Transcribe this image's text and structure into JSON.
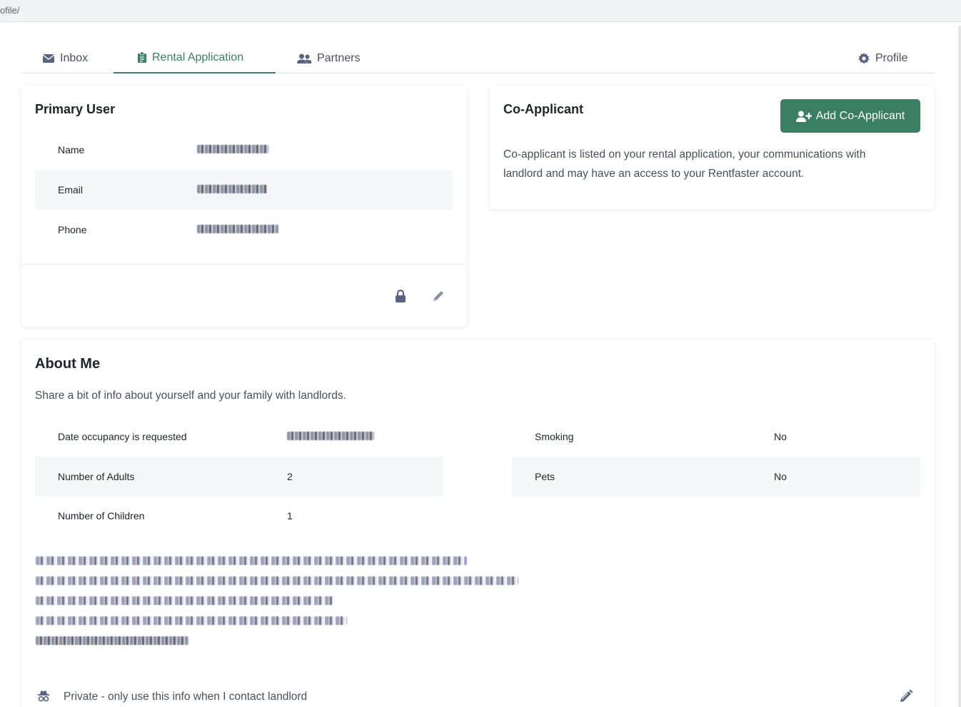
{
  "browser": {
    "url_fragment": "ofile/"
  },
  "tabs": [
    {
      "label": "Inbox",
      "icon": "envelope-icon"
    },
    {
      "label": "Rental Application",
      "icon": "clipboard-icon",
      "active": true
    },
    {
      "label": "Partners",
      "icon": "users-icon"
    },
    {
      "label": "Profile",
      "icon": "gear-icon"
    }
  ],
  "primary_user": {
    "title": "Primary User",
    "fields": [
      {
        "label": "Name",
        "value": "[redacted]"
      },
      {
        "label": "Email",
        "value": "[redacted]"
      },
      {
        "label": "Phone",
        "value": "[redacted]"
      }
    ]
  },
  "co_applicant": {
    "title": "Co-Applicant",
    "add_button": "Add Co-Applicant",
    "description_line1": "Co-applicant is listed on your rental application, your communications with",
    "description_line2": "landlord and may have an access to your Rentfaster account."
  },
  "about_me": {
    "title": "About Me",
    "subtitle": "Share a bit of info about yourself and your family with landlords.",
    "left_fields": [
      {
        "label": "Date occupancy is requested",
        "value": "[redacted]"
      },
      {
        "label": "Number of Adults",
        "value": "2"
      },
      {
        "label": "Number of Children",
        "value": "1"
      }
    ],
    "right_fields": [
      {
        "label": "Smoking",
        "value": "No"
      },
      {
        "label": "Pets",
        "value": "No"
      }
    ],
    "bio_lines": [
      "[redacted]",
      "[redacted]",
      "[redacted]",
      "[redacted]",
      "[redacted]"
    ],
    "privacy_note": "Private - only use this info when I contact landlord"
  },
  "colors": {
    "accent": "#3b7f62",
    "icon": "#5b6384"
  }
}
